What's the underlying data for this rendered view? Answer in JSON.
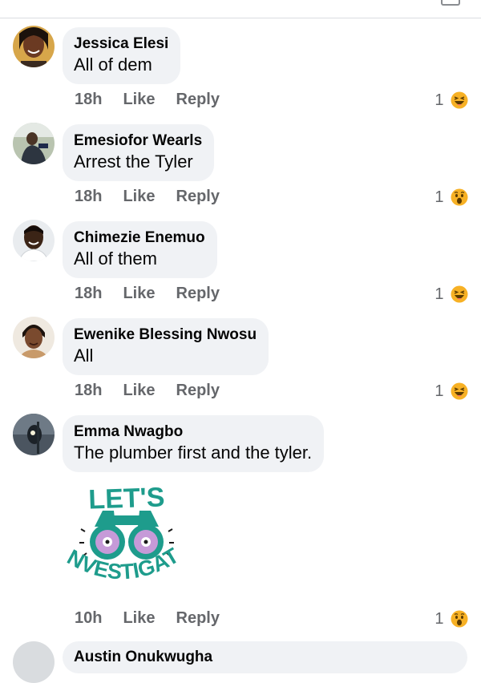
{
  "colors": {
    "bubble_bg": "#f0f2f5",
    "meta_text": "#65676b",
    "reaction_yellow": "#f7b125"
  },
  "actions": {
    "like": "Like",
    "reply": "Reply"
  },
  "comments": [
    {
      "author": "Jessica Elesi",
      "text": "All of dem",
      "time": "18h",
      "reaction_count": "1",
      "reaction": "haha-emoji"
    },
    {
      "author": "Emesiofor Wearls",
      "text": "Arrest the Tyler",
      "time": "18h",
      "reaction_count": "1",
      "reaction": "wow-emoji"
    },
    {
      "author": "Chimezie Enemuo",
      "text": "All of them",
      "time": "18h",
      "reaction_count": "1",
      "reaction": "haha-emoji"
    },
    {
      "author": "Ewenike Blessing Nwosu",
      "text": "All",
      "time": "18h",
      "reaction_count": "1",
      "reaction": "haha-emoji"
    },
    {
      "author": "Emma Nwagbo",
      "text": "The plumber first and the tyler.",
      "time": "10h",
      "reaction_count": "1",
      "reaction": "wow-emoji"
    }
  ],
  "sticker": {
    "line1": "LET'S",
    "line2": "INVESTIGATE",
    "icon": "binoculars-icon"
  },
  "partial_comment": {
    "author": "Austin Onukwugha"
  }
}
